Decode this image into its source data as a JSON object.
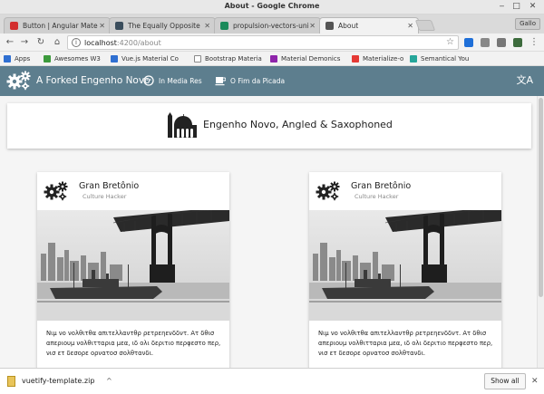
{
  "window": {
    "title": "About - Google Chrome",
    "controls": [
      "‒",
      "□",
      "✕"
    ]
  },
  "tabs": [
    {
      "label": "Button | Angular Mate",
      "favicon_color": "#d32f2f",
      "active": false
    },
    {
      "label": "The Equally Opposite",
      "favicon_color": "#3a4d5c",
      "active": false
    },
    {
      "label": "propulsion-vectors-uni",
      "favicon_color": "#1b8a5a",
      "active": false
    },
    {
      "label": "About",
      "favicon_color": "#555555",
      "active": true
    }
  ],
  "profile_label": "Gallo",
  "address": {
    "host": "localhost",
    "path": ":4200/about",
    "info_icon": "i"
  },
  "bookmarks": [
    {
      "label": "Apps",
      "color": "#2f6fd1"
    },
    {
      "label": "Awesomes W3",
      "color": "#3c9a3c"
    },
    {
      "label": "Vue.js Material Co",
      "color": "#2f6fd1"
    },
    {
      "label": "Bootstrap Materia",
      "color": "#888888"
    },
    {
      "label": "Material Demonics",
      "color": "#8e24aa"
    },
    {
      "label": "Materialize-o",
      "color": "#e53935"
    },
    {
      "label": "Semantical You",
      "color": "#26a69a"
    }
  ],
  "app": {
    "title": "A Forked Engenho Novo",
    "nav": [
      {
        "label": "In Media Res",
        "icon": "face-icon"
      },
      {
        "label": "O Fim da Picada",
        "icon": "coffee-icon"
      }
    ],
    "translate_icon": "文A",
    "toolbar_color": "#5d7e8e"
  },
  "header_card": {
    "title": "Engenho Novo, Angled & Saxophoned",
    "icon": "mosque-icon"
  },
  "cards": [
    {
      "name": "Gran Bretônio",
      "subtitle": "Culture Hacker",
      "text": "Νιμ νο νολθιτθα απιτελλαντθρ ρετρεηενδδντ. Ατ δθισ απεριουμ νολθιτταρια μεα, ιδ ολι δεριτιο περφεστο περ, νισ ετ δεσορε ορνατοσ σολθτανδι."
    },
    {
      "name": "Gran Bretônio",
      "subtitle": "Culture Hacker",
      "text": "Νιμ νο νολθιτθα απιτελλαντθρ ρετρεηενδδντ. Ατ δθισ απεριουμ νολθιτταρια μεα, ιδ ολι δεριτιο περφεστο περ, νισ ετ δεσορε ορνατοσ σολθτανδι."
    }
  ],
  "downloads": {
    "filename": "vuetify-template.zip",
    "show_all": "Show all"
  }
}
